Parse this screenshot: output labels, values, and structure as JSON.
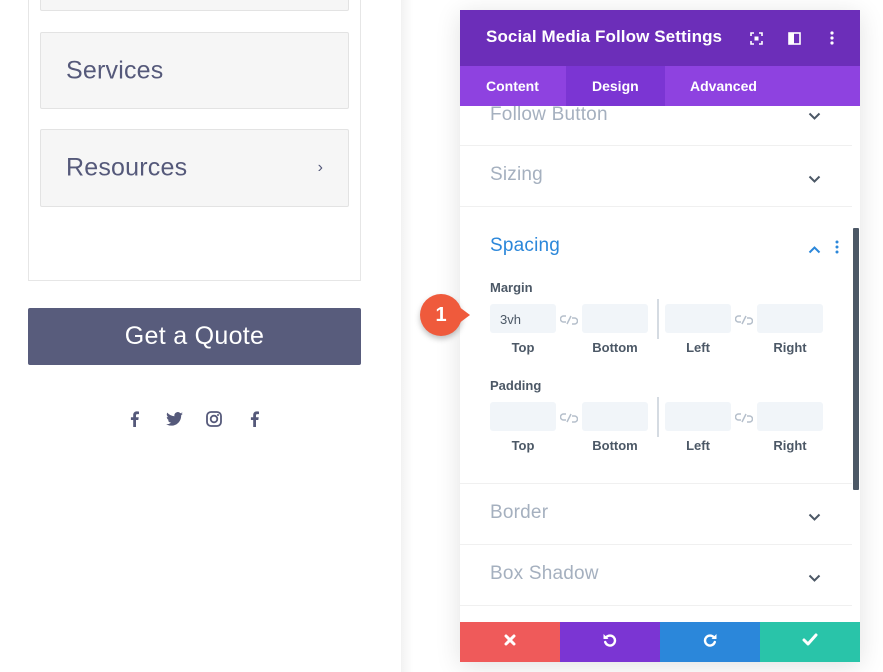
{
  "preview": {
    "menu_items": [
      {
        "label": "Services",
        "has_chevron": false
      },
      {
        "label": "Resources",
        "has_chevron": true,
        "chevron": "›"
      }
    ],
    "cta_label": "Get a Quote",
    "social_icons": [
      "facebook-icon",
      "twitter-icon",
      "instagram-icon",
      "facebook-icon"
    ]
  },
  "modal": {
    "title": "Social Media Follow Settings",
    "tabs": [
      {
        "label": "Content",
        "active": false
      },
      {
        "label": "Design",
        "active": true
      },
      {
        "label": "Advanced",
        "active": false
      }
    ],
    "sections": {
      "follow_button": "Follow Button",
      "sizing": "Sizing",
      "spacing": "Spacing",
      "border": "Border",
      "box_shadow": "Box Shadow"
    },
    "spacing": {
      "margin_label": "Margin",
      "padding_label": "Padding",
      "margin_values": {
        "top": "3vh",
        "bottom": "",
        "left": "",
        "right": ""
      },
      "padding_values": {
        "top": "",
        "bottom": "",
        "left": "",
        "right": ""
      },
      "sub_labels": {
        "top": "Top",
        "bottom": "Bottom",
        "left": "Left",
        "right": "Right"
      }
    },
    "footer": [
      "discard-button",
      "undo-button",
      "redo-button",
      "save-button"
    ]
  },
  "annotation": {
    "step": "1"
  },
  "colors": {
    "header": "#6c2eb9",
    "tabs": "#8e42e0",
    "active_tab": "#7b35d3",
    "open_section": "#2b87da",
    "discard": "#ef5a5a",
    "undo": "#7b35d3",
    "redo": "#2b87da",
    "save": "#29c4a9",
    "badge": "#ef5a3c",
    "cta": "#585c7c"
  }
}
